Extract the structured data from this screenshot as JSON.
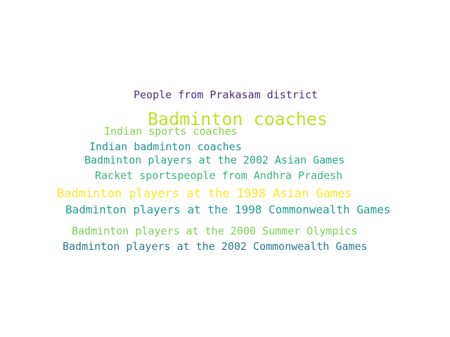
{
  "word_cloud": {
    "words": [
      {
        "text": "People from Prakasam district",
        "color": "#472d7b"
      },
      {
        "text": "Badminton coaches",
        "color": "#bddf26"
      },
      {
        "text": "Indian sports coaches",
        "color": "#84d44b"
      },
      {
        "text": "Indian badminton coaches",
        "color": "#21918c"
      },
      {
        "text": "Badminton players at the 2002 Asian Games",
        "color": "#22a884"
      },
      {
        "text": "Racket sportspeople from Andhra Pradesh",
        "color": "#35b779"
      },
      {
        "text": "Badminton players at the 1998 Asian Games",
        "color": "#fde725"
      },
      {
        "text": "Badminton players at the 1998 Commonwealth Games",
        "color": "#1f9e89"
      },
      {
        "text": "Badminton players at the 2000 Summer Olympics",
        "color": "#7ad151"
      },
      {
        "text": "Badminton players at the 2002 Commonwealth Games",
        "color": "#2a788e"
      }
    ]
  }
}
